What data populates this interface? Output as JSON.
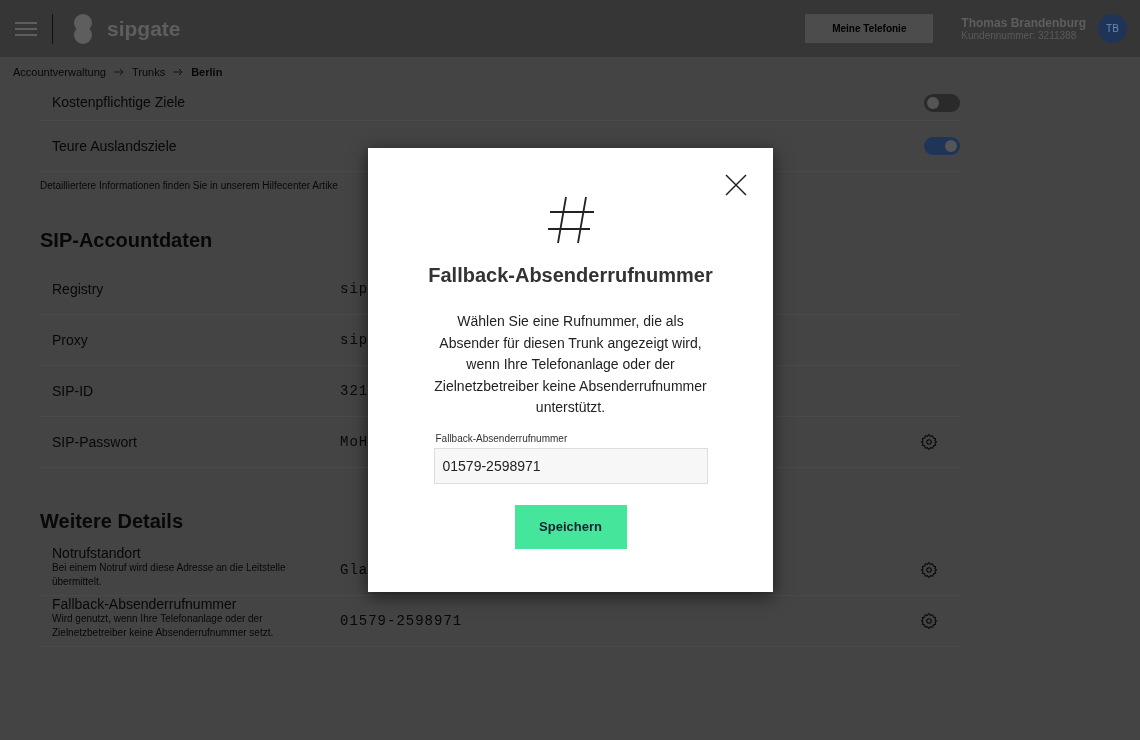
{
  "header": {
    "brand": "sipgate",
    "button": "Meine Telefonie",
    "user_name": "Thomas Brandenburg",
    "customer_number": "Kundennummer: 3211388",
    "avatar_initials": "TB"
  },
  "breadcrumb": [
    "Accountverwaltung",
    "Trunks",
    "Berlin"
  ],
  "toggles": [
    {
      "label": "Kostenpflichtige Ziele",
      "on": false
    },
    {
      "label": "Teure Auslandsziele",
      "on": true
    }
  ],
  "note": "Detailliertere Informationen finden Sie in unserem Hilfecenter Artike",
  "sections": [
    {
      "title": "SIP-Accountdaten",
      "rows": [
        {
          "label": "Registry",
          "value": "sip",
          "gear": false
        },
        {
          "label": "Proxy",
          "value": "sip",
          "gear": false
        },
        {
          "label": "SIP-ID",
          "value": "321",
          "gear": false
        },
        {
          "label": "SIP-Passwort",
          "value": "MoH",
          "gear": true
        }
      ]
    },
    {
      "title": "Weitere Details",
      "rows": [
        {
          "label": "Notrufstandort",
          "description": "Bei einem Notruf wird diese Adresse an die Leitstelle übermittelt.",
          "value": "Gla",
          "gear": true
        },
        {
          "label": "Fallback-Absenderrufnummer",
          "description": "Wird genutzt, wenn Ihre Telefonanlage oder der Zielnetzbetreiber keine Absenderrufnummer setzt.",
          "value": "01579-2598971",
          "gear": true
        }
      ]
    }
  ],
  "modal": {
    "title": "Fallback-Absenderrufnummer",
    "message": "Wählen Sie eine Rufnummer, die als Absender für diesen Trunk angezeigt wird, wenn Ihre Telefonanlage oder der Zielnetzbetreiber keine Absenderrufnummer unterstützt.",
    "field_label": "Fallback-Absenderrufnummer",
    "field_value": "01579-2598971",
    "button": "Speichern"
  }
}
